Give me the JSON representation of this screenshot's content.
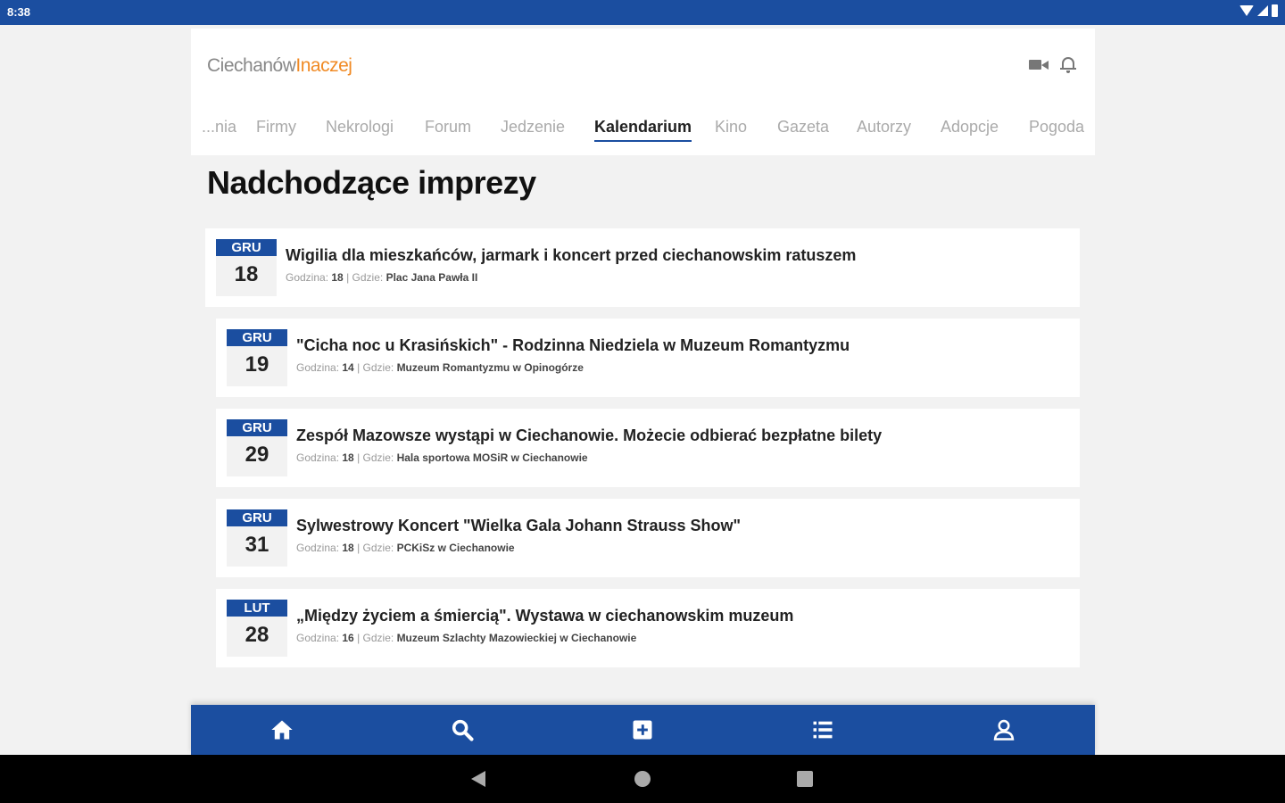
{
  "status_bar": {
    "time": "8:38"
  },
  "header": {
    "logo_part1": "Ciechanów",
    "logo_part2": "Inaczej"
  },
  "tabs": [
    "...nia",
    "Firmy",
    "Nekrologi",
    "Forum",
    "Jedzenie",
    "Kalendarium",
    "Kino",
    "Gazeta",
    "Autorzy",
    "Adopcje",
    "Pogoda"
  ],
  "active_tab": "Kalendarium",
  "page_title": "Nadchodzące imprezy",
  "events": [
    {
      "month": "GRU",
      "day": "18",
      "title": "Wigilia dla mieszkańców, jarmark i koncert przed ciechanowskim ratuszem",
      "time_label": "Godzina:",
      "time": "18",
      "place_label": "| Gdzie:",
      "place": "Plac Jana Pawła II"
    },
    {
      "month": "GRU",
      "day": "19",
      "title": "\"Cicha noc u Krasińskich\" - Rodzinna Niedziela w Muzeum Romantyzmu",
      "time_label": "Godzina:",
      "time": "14",
      "place_label": "| Gdzie:",
      "place": "Muzeum Romantyzmu w Opinogórze"
    },
    {
      "month": "GRU",
      "day": "29",
      "title": "Zespół Mazowsze wystąpi w Ciechanowie. Możecie odbierać bezpłatne bilety",
      "time_label": "Godzina:",
      "time": "18",
      "place_label": "| Gdzie:",
      "place": "Hala sportowa MOSiR w Ciechanowie"
    },
    {
      "month": "GRU",
      "day": "31",
      "title": "Sylwestrowy Koncert \"Wielka Gala Johann Strauss Show\"",
      "time_label": "Godzina:",
      "time": "18",
      "place_label": "| Gdzie:",
      "place": "PCKiSz w Ciechanowie"
    },
    {
      "month": "LUT",
      "day": "28",
      "title": "„Między życiem a śmiercią\". Wystawa w ciechanowskim muzeum",
      "time_label": "Godzina:",
      "time": "16",
      "place_label": "| Gdzie:",
      "place": "Muzeum Szlachty Mazowieckiej w Ciechanowie"
    }
  ],
  "bottom_nav": [
    {
      "icon": "home-icon"
    },
    {
      "icon": "search-icon"
    },
    {
      "icon": "add-post-icon"
    },
    {
      "icon": "list-icon"
    },
    {
      "icon": "user-icon"
    }
  ],
  "colors": {
    "brand_blue": "#1b4ea0",
    "logo_orange": "#f08a24"
  }
}
